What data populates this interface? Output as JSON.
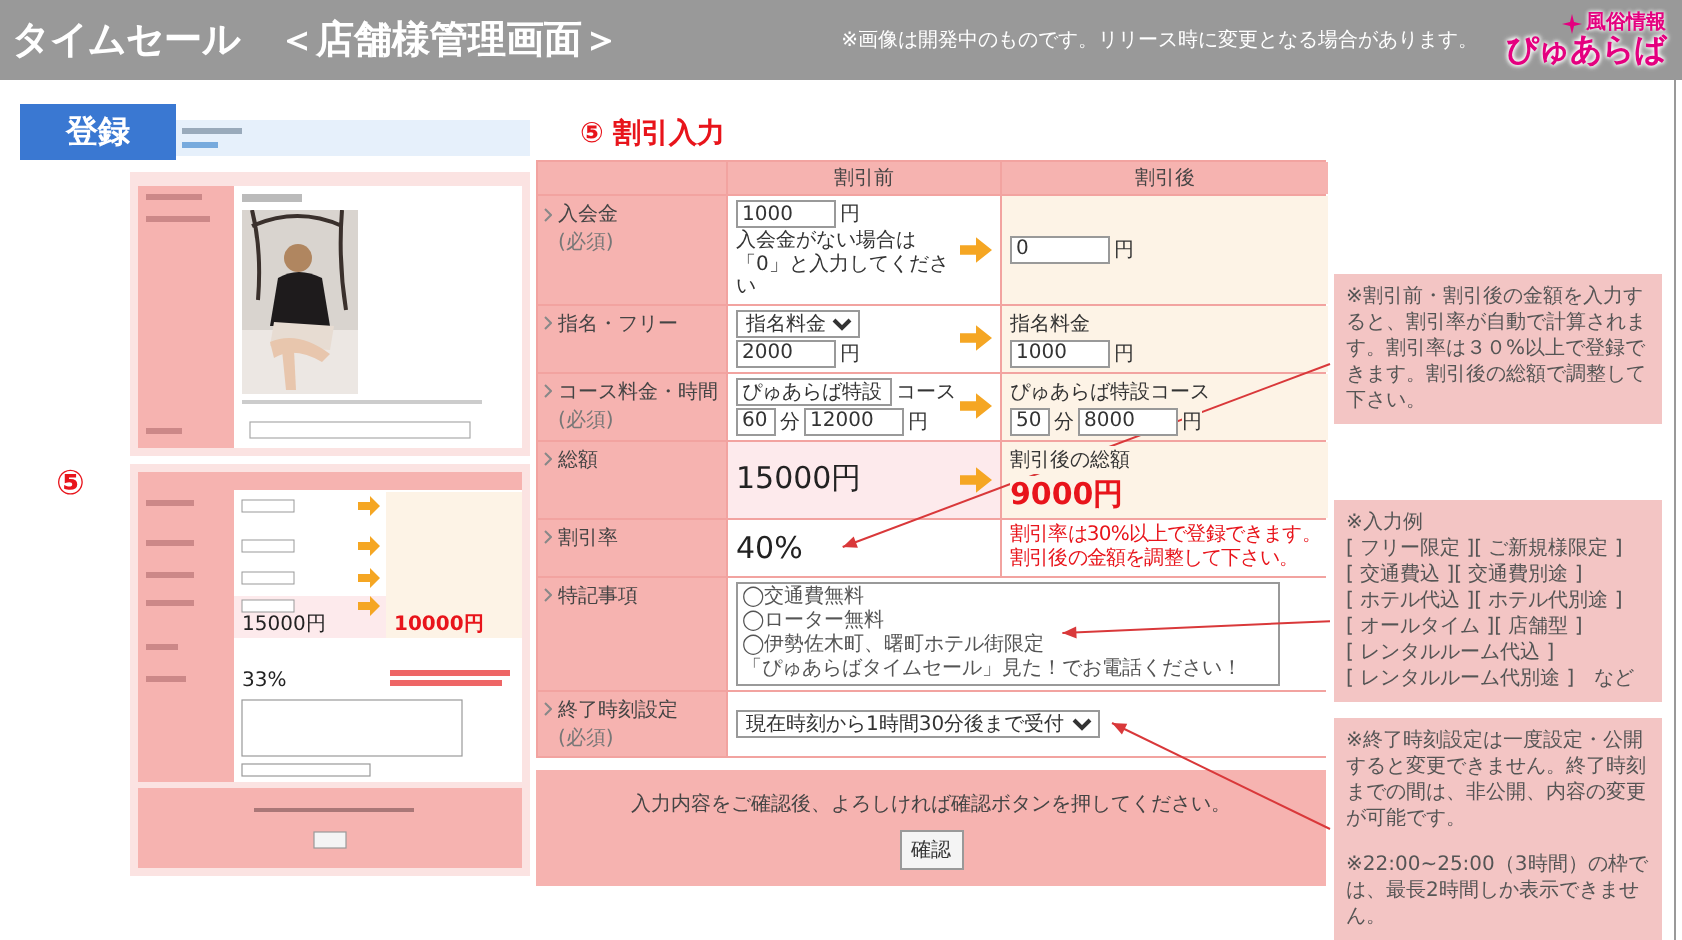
{
  "header": {
    "title": "タイムセール　＜店舗様管理画面＞",
    "notice": "※画像は開発中のものです。リリース時に変更となる場合があります。",
    "logo": {
      "tagline": "風俗情報",
      "name": "ぴゅあらば"
    }
  },
  "badge": "登録",
  "step_marker": "⑤",
  "thumbnail": {
    "total_before": "15000円",
    "total_after": "10000円",
    "rate": "33%"
  },
  "section_title": "⑤ 割引入力",
  "form": {
    "columns": [
      "割引前",
      "割引後"
    ],
    "rows": [
      {
        "kind": "split",
        "label": "入会金",
        "required": "(必須)",
        "arrow": true,
        "before": [
          [
            {
              "kind": "input",
              "value": "1000"
            },
            {
              "kind": "unit",
              "value": "円"
            }
          ],
          [
            {
              "kind": "hint",
              "value": "入会金がない場合は「0」と入力してください"
            }
          ]
        ],
        "after": [
          [
            {
              "kind": "input",
              "value": "0"
            },
            {
              "kind": "unit",
              "value": "円"
            }
          ]
        ]
      },
      {
        "kind": "split",
        "label": "指名・フリー",
        "arrow": true,
        "before": [
          [
            {
              "kind": "select",
              "value": "指名料金"
            }
          ],
          [
            {
              "kind": "input",
              "value": "2000"
            },
            {
              "kind": "unit",
              "value": "円"
            }
          ]
        ],
        "after": [
          [
            {
              "kind": "text",
              "value": "指名料金"
            }
          ],
          [
            {
              "kind": "input",
              "value": "1000"
            },
            {
              "kind": "unit",
              "value": "円"
            }
          ]
        ]
      },
      {
        "kind": "split",
        "label": "コース料金・時間",
        "required": "(必須)",
        "arrow": true,
        "before": [
          [
            {
              "kind": "input",
              "value": "ぴゅあらば特設"
            },
            {
              "kind": "unit",
              "value": "コース"
            }
          ],
          [
            {
              "kind": "short_input",
              "value": "60"
            },
            {
              "kind": "unit",
              "value": "分"
            },
            {
              "kind": "input",
              "value": "12000"
            },
            {
              "kind": "unit",
              "value": "円"
            }
          ]
        ],
        "after": [
          [
            {
              "kind": "text",
              "value": "ぴゅあらば特設コース"
            }
          ],
          [
            {
              "kind": "short_input",
              "value": "50"
            },
            {
              "kind": "unit",
              "value": "分"
            },
            {
              "kind": "input",
              "value": "8000"
            },
            {
              "kind": "unit",
              "value": "円"
            }
          ]
        ]
      },
      {
        "kind": "total",
        "label": "総額",
        "arrow": true,
        "before": [
          [
            {
              "kind": "amount",
              "value": "15000円"
            }
          ]
        ],
        "after": [
          [
            {
              "kind": "text",
              "value": "割引後の総額"
            }
          ],
          [
            {
              "kind": "alert_amount",
              "value": "9000円"
            }
          ]
        ]
      },
      {
        "kind": "split",
        "label": "割引率",
        "arrow": false,
        "before": [
          [
            {
              "kind": "amount",
              "value": "40%"
            }
          ]
        ],
        "after": [
          [
            {
              "kind": "alert",
              "value": "割引率は30%以上で登録できます。"
            }
          ],
          [
            {
              "kind": "alert",
              "value": "割引後の金額を調整して下さい。"
            }
          ]
        ]
      },
      {
        "kind": "wide",
        "label": "特記事項",
        "value": [
          [
            {
              "kind": "textarea",
              "lines": [
                "◯交通費無料",
                "◯ローター無料",
                "◯伊勢佐木町、曙町ホテル街限定",
                "「ぴゅあらばタイムセール」見た！でお電話ください！"
              ]
            }
          ]
        ]
      },
      {
        "kind": "wide",
        "label": "終了時刻設定",
        "required": "(必須)",
        "value": [
          [
            {
              "kind": "select",
              "value": "現在時刻から1時間30分後まで受付"
            }
          ]
        ]
      }
    ]
  },
  "submit": {
    "message": "入力内容をご確認後、よろしければ確認ボタンを押してください。",
    "button": "確認"
  },
  "notes": [
    {
      "lines": [
        "※割引前・割引後の金額を入力すると、割引率が自動で計算されます。割引率は３０%以上で登録できます。割引後の総額で調整して下さい。"
      ]
    },
    {
      "lines": [
        "※入力例",
        "[ フリー限定 ][ ご新規様限定 ]",
        "[ 交通費込 ][ 交通費別途 ]",
        "[ ホテル代込 ][ ホテル代別途 ]",
        "[ オールタイム ][ 店舗型 ]",
        "[ レンタルルーム代込 ]",
        "[ レンタルルーム代別途 ]　など"
      ]
    },
    {
      "lines": [
        "※終了時刻設定は一度設定・公開すると変更できません。終了時刻までの間は、非公開、内容の変更が可能です。",
        "※22:00~25:00（3時間）の枠では、最長2時間しか表示できません。"
      ]
    }
  ]
}
